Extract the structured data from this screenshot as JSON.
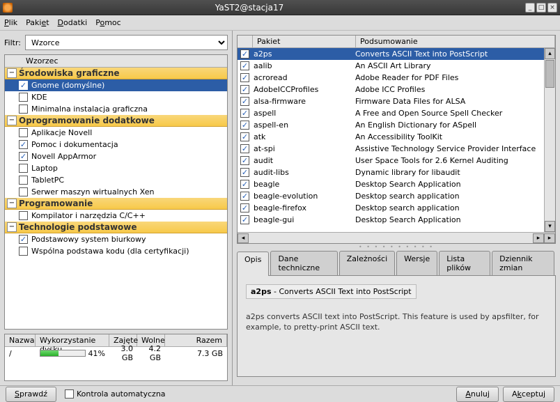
{
  "window": {
    "title": "YaST2@stacja17"
  },
  "menubar": {
    "plik": "Plik",
    "pakiet": "Pakiet",
    "dodatki": "Dodatki",
    "pomoc": "Pomoc"
  },
  "filter": {
    "label": "Filtr:",
    "value": "Wzorce"
  },
  "pattern_header": "Wzorzec",
  "groups": [
    {
      "label": "Środowiska graficzne",
      "items": [
        {
          "label": "Gnome (domyślne)",
          "checked": true,
          "selected": true
        },
        {
          "label": "KDE",
          "checked": false
        },
        {
          "label": "Minimalna instalacja graficzna",
          "checked": false
        }
      ]
    },
    {
      "label": "Oprogramowanie dodatkowe",
      "items": [
        {
          "label": "Aplikacje Novell",
          "checked": false
        },
        {
          "label": "Pomoc i dokumentacja",
          "checked": true
        },
        {
          "label": "Novell AppArmor",
          "checked": true
        },
        {
          "label": "Laptop",
          "checked": false
        },
        {
          "label": "TabletPC",
          "checked": false
        },
        {
          "label": "Serwer maszyn wirtualnych Xen",
          "checked": false
        }
      ]
    },
    {
      "label": "Programowanie",
      "items": [
        {
          "label": "Kompilator i narzędzia C/C++",
          "checked": false
        }
      ]
    },
    {
      "label": "Technologie podstawowe",
      "items": [
        {
          "label": "Podstawowy system biurkowy",
          "checked": true
        },
        {
          "label": "Wspólna podstawa kodu (dla certyfikacji)",
          "checked": false
        }
      ]
    }
  ],
  "disk": {
    "headers": {
      "name": "Nazwa",
      "usage": "Wykorzystanie dysku",
      "used": "Zajęte",
      "free": "Wolne",
      "total": "Razem"
    },
    "row": {
      "name": "/",
      "percent": "41%",
      "percent_val": 41,
      "used": "3.0 GB",
      "free": "4.2 GB",
      "total": "7.3 GB"
    }
  },
  "pkg_headers": {
    "name": "Pakiet",
    "summary": "Podsumowanie"
  },
  "packages": [
    {
      "name": "a2ps",
      "summary": "Converts ASCII Text into PostScript",
      "checked": true,
      "selected": true
    },
    {
      "name": "aalib",
      "summary": "An ASCII Art Library",
      "checked": true
    },
    {
      "name": "acroread",
      "summary": "Adobe Reader for PDF Files",
      "checked": true
    },
    {
      "name": "AdobeICCProfiles",
      "summary": "Adobe ICC Profiles",
      "checked": true
    },
    {
      "name": "alsa-firmware",
      "summary": "Firmware Data Files for ALSA",
      "checked": true
    },
    {
      "name": "aspell",
      "summary": "A Free and Open Source Spell Checker",
      "checked": true
    },
    {
      "name": "aspell-en",
      "summary": "An English Dictionary for ASpell",
      "checked": true
    },
    {
      "name": "atk",
      "summary": "An Accessibility ToolKit",
      "checked": true
    },
    {
      "name": "at-spi",
      "summary": "Assistive Technology Service Provider Interface",
      "checked": true
    },
    {
      "name": "audit",
      "summary": "User Space Tools for 2.6 Kernel Auditing",
      "checked": true
    },
    {
      "name": "audit-libs",
      "summary": "Dynamic library for libaudit",
      "checked": true
    },
    {
      "name": "beagle",
      "summary": "Desktop Search Application",
      "checked": true
    },
    {
      "name": "beagle-evolution",
      "summary": "Desktop search application",
      "checked": true
    },
    {
      "name": "beagle-firefox",
      "summary": "Desktop search application",
      "checked": true
    },
    {
      "name": "beagle-gui",
      "summary": "Desktop Search Application",
      "checked": true
    }
  ],
  "tabs": {
    "opis": "Opis",
    "dane": "Dane techniczne",
    "zalez": "Zależności",
    "wersje": "Wersje",
    "lista": "Lista plików",
    "dziennik": "Dziennik zmian"
  },
  "desc": {
    "title_name": "a2ps",
    "title_sep": " - ",
    "title_sum": "Converts ASCII Text into PostScript",
    "body": "a2ps converts ASCII text into PostScript. This feature is used by apsfilter, for example, to pretty-print ASCII text."
  },
  "buttons": {
    "check": "Sprawdź",
    "auto": "Kontrola automatyczna",
    "cancel": "Anuluj",
    "accept": "Akceptuj"
  }
}
